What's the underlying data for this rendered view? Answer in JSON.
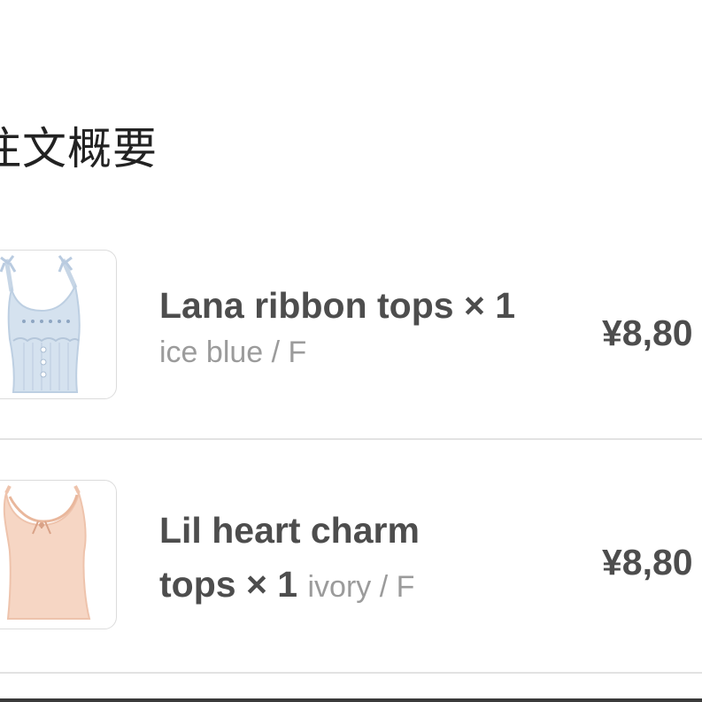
{
  "order_summary": {
    "title": "注文概要",
    "items": [
      {
        "name": "Lana ribbon tops",
        "quantity": "× 1",
        "variant": "ice blue / F",
        "price": "¥8,80",
        "image_icon": "blue-camisole-top"
      },
      {
        "name_line1": "Lil heart charm",
        "name_line2": "tops",
        "quantity": "× 1",
        "variant": "ivory / F",
        "price": "¥8,80",
        "image_icon": "peach-tank-top"
      }
    ]
  }
}
